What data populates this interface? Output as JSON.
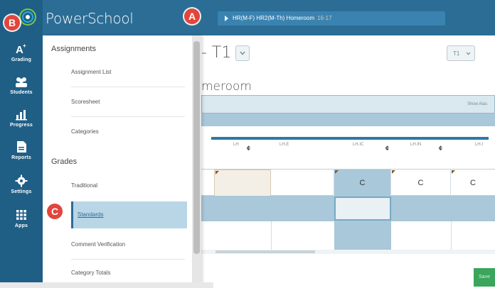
{
  "app": {
    "brand": "PowerSchool"
  },
  "section": {
    "label": "HR(M-F) HR2(M-Th) Homeroom",
    "term": "16-17"
  },
  "callouts": {
    "a": "A",
    "b": "B",
    "c": "C"
  },
  "rail": {
    "items": [
      {
        "label": "Grading",
        "icon": "grading-icon"
      },
      {
        "label": "Students",
        "icon": "students-icon"
      },
      {
        "label": "Progress",
        "icon": "progress-icon"
      },
      {
        "label": "Reports",
        "icon": "reports-icon"
      },
      {
        "label": "Settings",
        "icon": "gear-icon"
      },
      {
        "label": "Apps",
        "icon": "apps-grid-icon"
      }
    ]
  },
  "menu": {
    "groups": [
      {
        "title": "Assignments",
        "links": [
          "Assignment List",
          "Scoresheet",
          "Categories"
        ]
      },
      {
        "title": "Grades",
        "links": [
          "Traditional",
          "Standards",
          "Comment Verification",
          "Category Totals"
        ]
      }
    ],
    "active": "Standards"
  },
  "page": {
    "title": "- T1",
    "term_select": "T1",
    "subtitle": "meroom",
    "show_all": "Show Alas",
    "col_heads": [
      "LH",
      "LH.E",
      "LH.IC",
      "LH.IN",
      "LH.I"
    ],
    "grades": [
      "C",
      "C",
      "C"
    ],
    "save_label": "Save"
  },
  "colors": {
    "rail": "#1f5f86",
    "topbar": "#2b6d95",
    "accent": "#2b7aa7",
    "highlight": "#b9d6e6",
    "callout": "#e2453c"
  }
}
